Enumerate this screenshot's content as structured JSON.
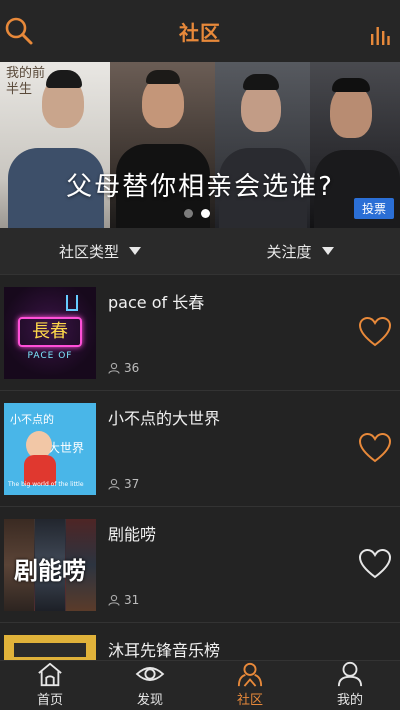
{
  "colors": {
    "accent": "#e8893a",
    "header_bg": "#262626",
    "vote_badge": "#2b6fd6"
  },
  "header": {
    "title": "社区",
    "left_icon": "search-icon",
    "right_icon": "stats-icon"
  },
  "banner": {
    "series_logo": "我的前半生",
    "slogan": "父母替你相亲会选谁?",
    "vote_label": "投票",
    "page_count": 2,
    "active_page": 2
  },
  "filters": [
    {
      "label": "社区类型",
      "icon": "triangle-down-icon"
    },
    {
      "label": "关注度",
      "icon": "triangle-down-icon"
    }
  ],
  "communities": [
    {
      "name": "pace of 长春",
      "members": "36",
      "liked": true,
      "thumb_text": "長春",
      "thumb_subtext": "PACE OF"
    },
    {
      "name": "小不点的大世界",
      "members": "37",
      "liked": true,
      "thumb_text": "小不点的",
      "thumb_text2": "大世界",
      "thumb_subtext": "The big world of the little"
    },
    {
      "name": "剧能唠",
      "members": "31",
      "liked": false,
      "thumb_text": "剧能唠"
    },
    {
      "name": "沐耳先锋音乐榜",
      "members": "",
      "liked": false
    }
  ],
  "nav": [
    {
      "label": "首页",
      "icon": "home-icon",
      "active": false
    },
    {
      "label": "发现",
      "icon": "eye-icon",
      "active": false
    },
    {
      "label": "社区",
      "icon": "community-icon",
      "active": true
    },
    {
      "label": "我的",
      "icon": "person-icon",
      "active": false
    }
  ]
}
